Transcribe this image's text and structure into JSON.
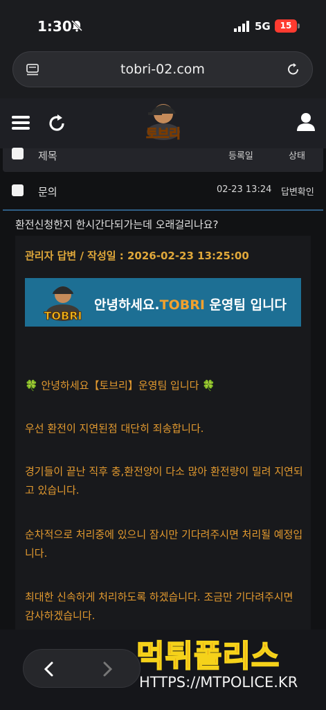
{
  "status_bar": {
    "time": "1:30",
    "network": "5G",
    "battery": "15"
  },
  "browser": {
    "url": "tobri-02.com"
  },
  "table": {
    "headers": {
      "title": "제목",
      "date": "등록일",
      "status": "상태"
    },
    "rows": [
      {
        "title": "문의",
        "date": "02-23 13:24",
        "status": "답변확인"
      }
    ]
  },
  "question": "환전신청한지 한시간다되가는데 오래걸리나요?",
  "answer": {
    "header": "관리자 답변 / 작성일 : 2026-02-23 13:25:00",
    "banner": {
      "logo": "TOBRI",
      "greeting": "안녕하세요.",
      "brand": "TOBRI",
      "team": " 운영팀 입니다"
    },
    "clover_left": "🍀",
    "greeting_line": " 안녕하세요【토브리】운영팀 입니다 ",
    "clover_right": "🍀",
    "paragraphs": [
      "우선 환전이 지연된점 대단히 죄송합니다.",
      "경기들이 끝난 직후 충,환전양이 다소 많아 환전량이 밀려 지연되고 있습니다.",
      "순차적으로 처리중에 있으니 잠시만 기다려주시면 처리될 예정입니다.",
      "최대한 신속하게 처리하도록 하겠습니다. 조금만 기다려주시면 감사하겠습니다."
    ]
  },
  "logo": {
    "text": "토브리"
  },
  "watermark": {
    "title": "먹튀폴리스",
    "url": "HTTPS://MTPOLICE.KR"
  },
  "colors": {
    "accent": "#e39a2f",
    "banner": "#1d6f94",
    "divider": "#2f5f86"
  }
}
